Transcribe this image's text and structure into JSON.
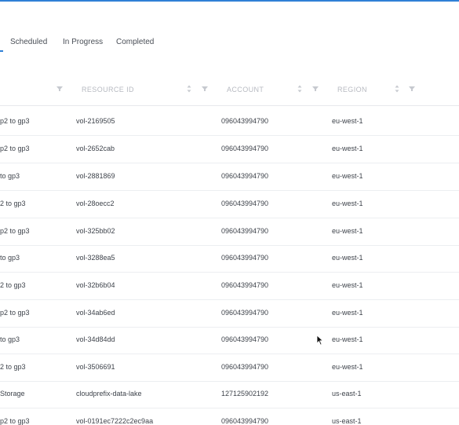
{
  "tabs": [
    {
      "label": "Scheduled"
    },
    {
      "label": "In Progress"
    },
    {
      "label": "Completed"
    }
  ],
  "table": {
    "headers": [
      "RESOURCE ID",
      "ACCOUNT",
      "REGION"
    ],
    "rows": [
      {
        "action": "p2 to gp3",
        "resource_id": "vol-2169505",
        "account": "096043994790",
        "region": "eu-west-1"
      },
      {
        "action": "p2 to gp3",
        "resource_id": "vol-2652cab",
        "account": "096043994790",
        "region": "eu-west-1"
      },
      {
        "action": "to gp3",
        "resource_id": "vol-2881869",
        "account": "096043994790",
        "region": "eu-west-1"
      },
      {
        "action": "2 to gp3",
        "resource_id": "vol-28oecc2",
        "account": "096043994790",
        "region": "eu-west-1"
      },
      {
        "action": "p2 to gp3",
        "resource_id": "vol-325bb02",
        "account": "096043994790",
        "region": "eu-west-1"
      },
      {
        "action": "to gp3",
        "resource_id": "vol-3288ea5",
        "account": "096043994790",
        "region": "eu-west-1"
      },
      {
        "action": "2 to gp3",
        "resource_id": "vol-32b6b04",
        "account": "096043994790",
        "region": "eu-west-1"
      },
      {
        "action": "p2 to gp3",
        "resource_id": "vol-34ab6ed",
        "account": "096043994790",
        "region": "eu-west-1"
      },
      {
        "action": "to gp3",
        "resource_id": "vol-34d84dd",
        "account": "096043994790",
        "region": "eu-west-1"
      },
      {
        "action": "2 to gp3",
        "resource_id": "vol-3506691",
        "account": "096043994790",
        "region": "eu-west-1"
      },
      {
        "action": "Storage",
        "resource_id": "cloudprefix-data-lake",
        "account": "127125902192",
        "region": "us-east-1"
      },
      {
        "action": "p2 to gp3",
        "resource_id": "vol-0191ec7222c2ec9aa",
        "account": "096043994790",
        "region": "us-east-1"
      }
    ]
  },
  "colors": {
    "accent": "#2f80d6",
    "header_text": "#b7bac1",
    "row_border": "#eceef1"
  }
}
